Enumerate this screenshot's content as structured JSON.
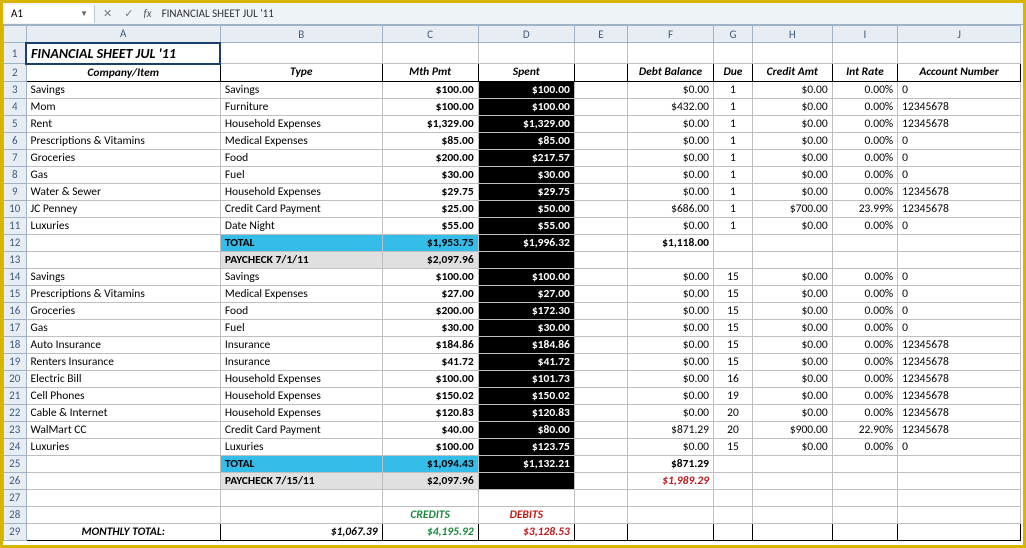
{
  "formula_bar": {
    "name_box": "A1",
    "fx": "fx",
    "value": "FINANCIAL SHEET JUL '11"
  },
  "col_letters": [
    "A",
    "B",
    "C",
    "D",
    "E",
    "F",
    "G",
    "H",
    "I",
    "J"
  ],
  "title": "FINANCIAL SHEET JUL '11",
  "headers": {
    "A": "Company/Item",
    "B": "Type",
    "C": "Mth Pmt",
    "D": "Spent",
    "E": "",
    "F": "Debt Balance",
    "G": "Due",
    "H": "Credit Amt",
    "I": "Int Rate",
    "J": "Account Number"
  },
  "rows": [
    {
      "r": 3,
      "A": "Savings",
      "B": "Savings",
      "C": "$100.00",
      "D": "$100.00",
      "F": "$0.00",
      "G": "1",
      "H": "$0.00",
      "I": "0.00%",
      "J": "0"
    },
    {
      "r": 4,
      "A": "Mom",
      "B": "Furniture",
      "C": "$100.00",
      "D": "$100.00",
      "F": "$432.00",
      "G": "1",
      "H": "$0.00",
      "I": "0.00%",
      "J": "12345678"
    },
    {
      "r": 5,
      "A": "Rent",
      "B": "Household Expenses",
      "C": "$1,329.00",
      "D": "$1,329.00",
      "F": "$0.00",
      "G": "1",
      "H": "$0.00",
      "I": "0.00%",
      "J": "12345678"
    },
    {
      "r": 6,
      "A": "Prescriptions & Vitamins",
      "B": "Medical Expenses",
      "C": "$85.00",
      "D": "$85.00",
      "F": "$0.00",
      "G": "1",
      "H": "$0.00",
      "I": "0.00%",
      "J": "0"
    },
    {
      "r": 7,
      "A": "Groceries",
      "B": "Food",
      "C": "$200.00",
      "D": "$217.57",
      "F": "$0.00",
      "G": "1",
      "H": "$0.00",
      "I": "0.00%",
      "J": "0"
    },
    {
      "r": 8,
      "A": "Gas",
      "B": "Fuel",
      "C": "$30.00",
      "D": "$30.00",
      "F": "$0.00",
      "G": "1",
      "H": "$0.00",
      "I": "0.00%",
      "J": "0"
    },
    {
      "r": 9,
      "A": "Water & Sewer",
      "B": "Household Expenses",
      "C": "$29.75",
      "D": "$29.75",
      "F": "$0.00",
      "G": "1",
      "H": "$0.00",
      "I": "0.00%",
      "J": "12345678"
    },
    {
      "r": 10,
      "A": "JC Penney",
      "B": "Credit Card Payment",
      "C": "$25.00",
      "D": "$50.00",
      "F": "$686.00",
      "G": "1",
      "H": "$700.00",
      "I": "23.99%",
      "J": "12345678"
    },
    {
      "r": 11,
      "A": "Luxuries",
      "B": "Date Night",
      "C": "$55.00",
      "D": "$55.00",
      "F": "$0.00",
      "G": "1",
      "H": "$0.00",
      "I": "0.00%",
      "J": "0"
    },
    {
      "r": 12,
      "type": "total",
      "B": "TOTAL",
      "C": "$1,953.75",
      "D": "$1,996.32",
      "F": "$1,118.00"
    },
    {
      "r": 13,
      "type": "pay",
      "B": "PAYCHECK 7/1/11",
      "C": "$2,097.96"
    },
    {
      "r": 14,
      "A": "Savings",
      "B": "Savings",
      "C": "$100.00",
      "D": "$100.00",
      "F": "$0.00",
      "G": "15",
      "H": "$0.00",
      "I": "0.00%",
      "J": "0"
    },
    {
      "r": 15,
      "A": "Prescriptions & Vitamins",
      "B": "Medical Expenses",
      "C": "$27.00",
      "D": "$27.00",
      "F": "$0.00",
      "G": "15",
      "H": "$0.00",
      "I": "0.00%",
      "J": "0"
    },
    {
      "r": 16,
      "A": "Groceries",
      "B": "Food",
      "C": "$200.00",
      "D": "$172.30",
      "F": "$0.00",
      "G": "15",
      "H": "$0.00",
      "I": "0.00%",
      "J": "0"
    },
    {
      "r": 17,
      "A": "Gas",
      "B": "Fuel",
      "C": "$30.00",
      "D": "$30.00",
      "F": "$0.00",
      "G": "15",
      "H": "$0.00",
      "I": "0.00%",
      "J": "0"
    },
    {
      "r": 18,
      "A": "Auto Insurance",
      "B": "Insurance",
      "C": "$184.86",
      "D": "$184.86",
      "F": "$0.00",
      "G": "15",
      "H": "$0.00",
      "I": "0.00%",
      "J": "12345678"
    },
    {
      "r": 19,
      "A": "Renters Insurance",
      "B": "Insurance",
      "C": "$41.72",
      "D": "$41.72",
      "F": "$0.00",
      "G": "15",
      "H": "$0.00",
      "I": "0.00%",
      "J": "12345678"
    },
    {
      "r": 20,
      "A": "Electric Bill",
      "B": "Household Expenses",
      "C": "$100.00",
      "D": "$101.73",
      "F": "$0.00",
      "G": "16",
      "H": "$0.00",
      "I": "0.00%",
      "J": "12345678"
    },
    {
      "r": 21,
      "A": "Cell Phones",
      "B": "Household Expenses",
      "C": "$150.02",
      "D": "$150.02",
      "F": "$0.00",
      "G": "19",
      "H": "$0.00",
      "I": "0.00%",
      "J": "12345678"
    },
    {
      "r": 22,
      "A": "Cable & Internet",
      "B": "Household Expenses",
      "C": "$120.83",
      "D": "$120.83",
      "F": "$0.00",
      "G": "20",
      "H": "$0.00",
      "I": "0.00%",
      "J": "12345678"
    },
    {
      "r": 23,
      "A": "WalMart CC",
      "B": "Credit Card Payment",
      "C": "$40.00",
      "D": "$80.00",
      "F": "$871.29",
      "G": "20",
      "H": "$900.00",
      "I": "22.90%",
      "J": "12345678"
    },
    {
      "r": 24,
      "A": "Luxuries",
      "B": "Luxuries",
      "C": "$100.00",
      "D": "$123.75",
      "F": "$0.00",
      "G": "15",
      "H": "$0.00",
      "I": "0.00%",
      "J": "0"
    },
    {
      "r": 25,
      "type": "total",
      "B": "TOTAL",
      "C": "$1,094.43",
      "D": "$1,132.21",
      "F": "$871.29"
    },
    {
      "r": 26,
      "type": "pay",
      "B": "PAYCHECK 7/15/11",
      "C": "$2,097.96",
      "F": "$1,989.29",
      "Fred": true
    }
  ],
  "row27": 27,
  "labels28": {
    "r": 28,
    "C": "CREDITS",
    "D": "DEBITS"
  },
  "monthly": {
    "r": 29,
    "A": "MONTHLY TOTAL:",
    "B": "$1,067.39",
    "C": "$4,195.92",
    "D": "$3,128.53"
  }
}
